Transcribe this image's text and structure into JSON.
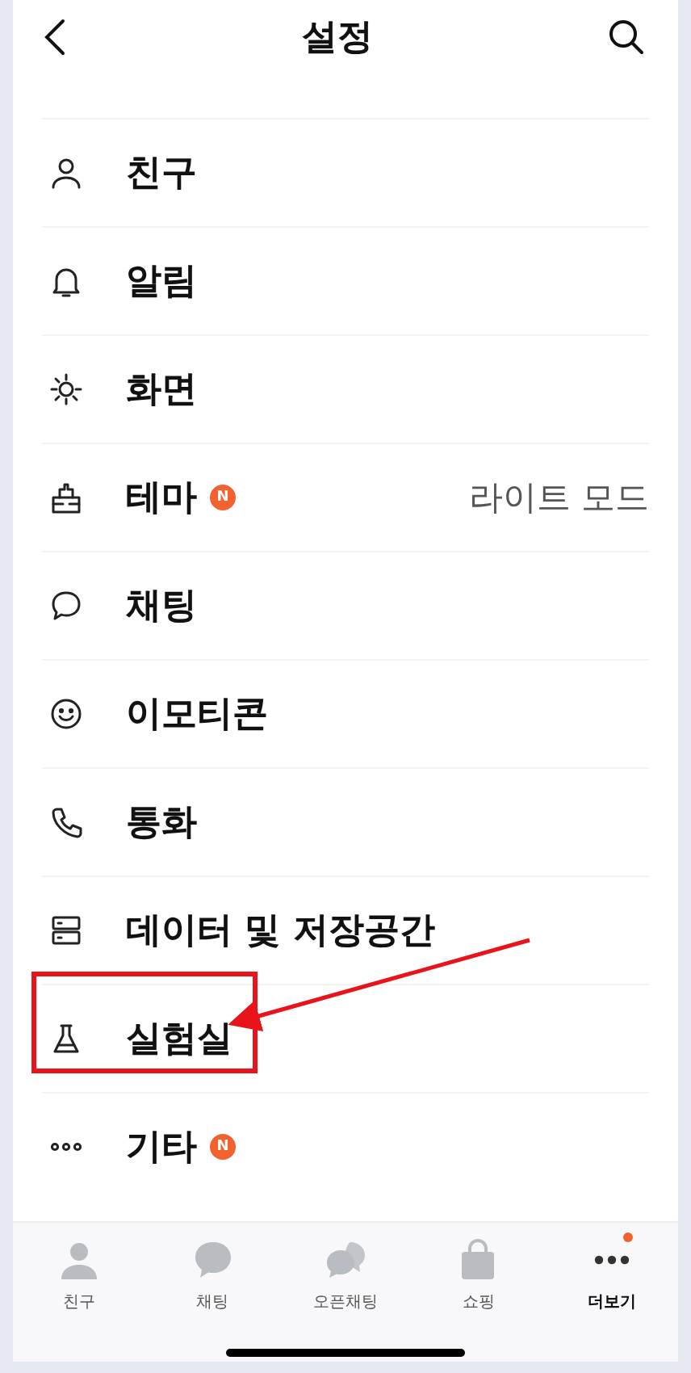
{
  "header": {
    "title": "설정"
  },
  "settings": [
    {
      "kind": "person",
      "label": "친구",
      "highlighted": false
    },
    {
      "kind": "bell",
      "label": "알림",
      "highlighted": false
    },
    {
      "kind": "sun",
      "label": "화면",
      "highlighted": false
    },
    {
      "kind": "brush",
      "label": "테마",
      "badge": "N",
      "value": "라이트 모드",
      "highlighted": false
    },
    {
      "kind": "bubble",
      "label": "채팅",
      "highlighted": false
    },
    {
      "kind": "smile",
      "label": "이모티콘",
      "highlighted": false
    },
    {
      "kind": "phone",
      "label": "통화",
      "highlighted": false
    },
    {
      "kind": "server",
      "label": "데이터 및 저장공간",
      "highlighted": false
    },
    {
      "kind": "flask",
      "label": "실험실",
      "highlighted": true
    },
    {
      "kind": "dots",
      "label": "기타",
      "badge": "N",
      "highlighted": false
    }
  ],
  "tab_bar": [
    {
      "kind": "person",
      "label": "친구",
      "selected": false,
      "dot": false
    },
    {
      "kind": "bubble",
      "label": "채팅",
      "selected": false,
      "dot": false
    },
    {
      "kind": "bubbles",
      "label": "오픈채팅",
      "selected": false,
      "dot": false
    },
    {
      "kind": "bag",
      "label": "쇼핑",
      "selected": false,
      "dot": false
    },
    {
      "kind": "dots",
      "label": "더보기",
      "selected": true,
      "dot": true
    }
  ]
}
